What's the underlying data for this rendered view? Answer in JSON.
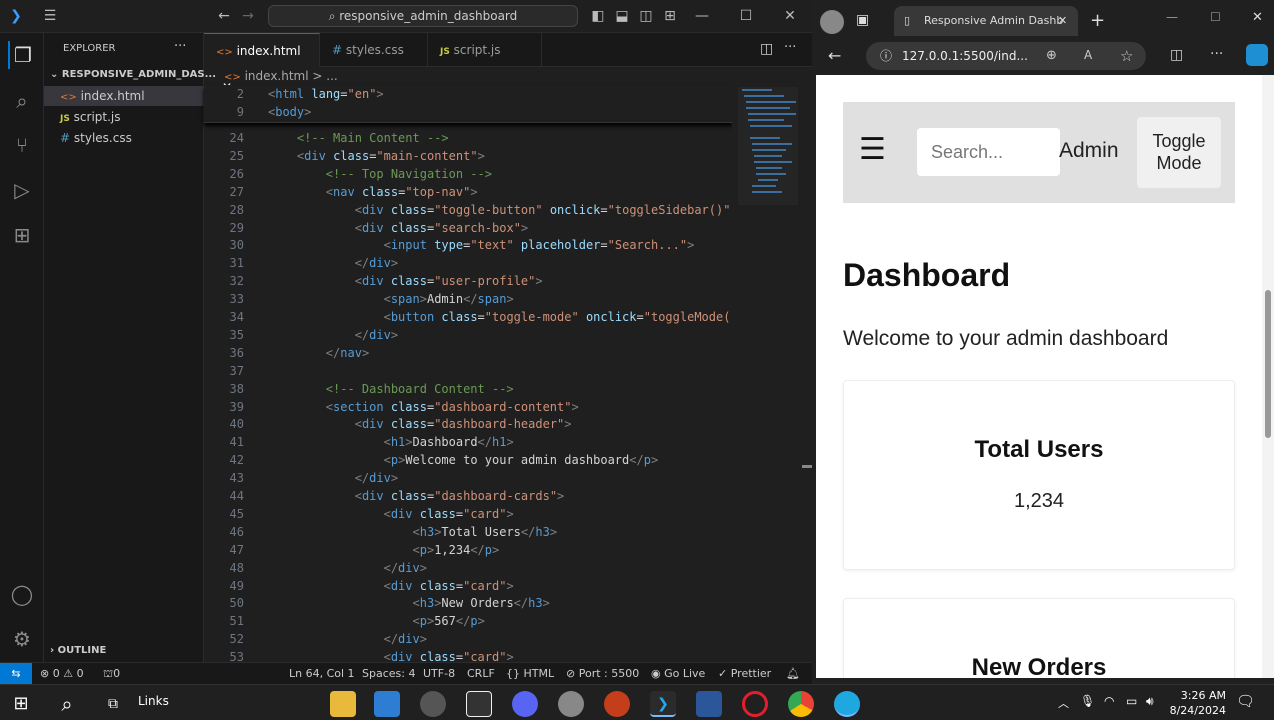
{
  "vscode": {
    "search": "responsive_admin_dashboard",
    "explorer": {
      "title": "EXPLORER",
      "folder": "RESPONSIVE_ADMIN_DAS...",
      "files": [
        {
          "name": "index.html",
          "icon": "<>"
        },
        {
          "name": "script.js",
          "icon": "JS"
        },
        {
          "name": "styles.css",
          "icon": "#"
        }
      ],
      "outline": "OUTLINE"
    },
    "tabs": [
      {
        "name": "index.html",
        "icon": "<>"
      },
      {
        "name": "styles.css",
        "icon": "#"
      },
      {
        "name": "script.js",
        "icon": "JS"
      }
    ],
    "breadcrumb": "index.html > ...",
    "sticky": [
      [
        "2",
        "<html lang=\"en\">"
      ],
      [
        "9",
        "<body>"
      ]
    ],
    "lines": [
      [
        "24",
        "    <!-- Main Content -->"
      ],
      [
        "25",
        "    <div class=\"main-content\">"
      ],
      [
        "26",
        "        <!-- Top Navigation -->"
      ],
      [
        "27",
        "        <nav class=\"top-nav\">"
      ],
      [
        "28",
        "            <div class=\"toggle-button\" onclick=\"toggleSidebar()\""
      ],
      [
        "29",
        "            <div class=\"search-box\">"
      ],
      [
        "30",
        "                <input type=\"text\" placeholder=\"Search...\">"
      ],
      [
        "31",
        "            </div>"
      ],
      [
        "32",
        "            <div class=\"user-profile\">"
      ],
      [
        "33",
        "                <span>Admin</span>"
      ],
      [
        "34",
        "                <button class=\"toggle-mode\" onclick=\"toggleMode("
      ],
      [
        "35",
        "            </div>"
      ],
      [
        "36",
        "        </nav>"
      ],
      [
        "37",
        ""
      ],
      [
        "38",
        "        <!-- Dashboard Content -->"
      ],
      [
        "39",
        "        <section class=\"dashboard-content\">"
      ],
      [
        "40",
        "            <div class=\"dashboard-header\">"
      ],
      [
        "41",
        "                <h1>Dashboard</h1>"
      ],
      [
        "42",
        "                <p>Welcome to your admin dashboard</p>"
      ],
      [
        "43",
        "            </div>"
      ],
      [
        "44",
        "            <div class=\"dashboard-cards\">"
      ],
      [
        "45",
        "                <div class=\"card\">"
      ],
      [
        "46",
        "                    <h3>Total Users</h3>"
      ],
      [
        "47",
        "                    <p>1,234</p>"
      ],
      [
        "48",
        "                </div>"
      ],
      [
        "49",
        "                <div class=\"card\">"
      ],
      [
        "50",
        "                    <h3>New Orders</h3>"
      ],
      [
        "51",
        "                    <p>567</p>"
      ],
      [
        "52",
        "                </div>"
      ],
      [
        "53",
        "                <div class=\"card\">"
      ]
    ],
    "status": {
      "errors": "0",
      "warnings": "0",
      "ports_count": "0",
      "position": "Ln 64, Col 1",
      "spaces": "Spaces: 4",
      "encoding": "UTF-8",
      "eol": "CRLF",
      "language": "HTML",
      "port": "Port : 5500",
      "golive": "Go Live",
      "prettier": "Prettier"
    }
  },
  "browser": {
    "tab_title": "Responsive Admin Dashb",
    "url": "127.0.0.1:5500/ind...",
    "page": {
      "search_placeholder": "Search...",
      "admin": "Admin",
      "toggle": "Toggle Mode",
      "heading": "Dashboard",
      "welcome": "Welcome to your admin dashboard",
      "cards": [
        {
          "title": "Total Users",
          "value": "1,234"
        },
        {
          "title": "New Orders"
        }
      ]
    }
  },
  "taskbar": {
    "links": "Links",
    "time": "3:26 AM",
    "date": "8/24/2024"
  }
}
